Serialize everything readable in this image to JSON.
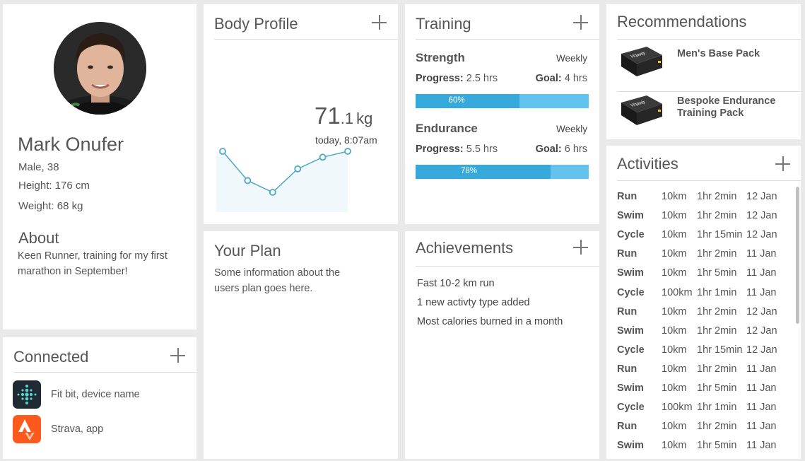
{
  "profile": {
    "name": "Mark Onufer",
    "gender_age": "Male, 38",
    "height": "Height: 176 cm",
    "weight": "Weight: 68 kg",
    "about_heading": "About",
    "about_text": "Keen Runner, training for my first marathon in September!"
  },
  "connected": {
    "title": "Connected",
    "items": [
      {
        "label": "Fit bit, device name",
        "icon": "fitbit-icon"
      },
      {
        "label": "Strava, app",
        "icon": "strava-icon"
      }
    ]
  },
  "body_profile": {
    "title": "Body Profile",
    "weight_int": "71",
    "weight_dec": ".1",
    "weight_unit": "kg",
    "weight_time": "today, 8:07am",
    "trend": [
      5,
      2.5,
      1.5,
      3.5,
      4.5,
      5
    ]
  },
  "plan": {
    "title": "Your Plan",
    "text": "Some information about the users plan goes here."
  },
  "training": {
    "title": "Training",
    "items": [
      {
        "name": "Strength",
        "period": "Weekly",
        "progress_label": "Progress:",
        "progress_value": "2.5 hrs",
        "goal_label": "Goal:",
        "goal_value": "4 hrs",
        "percent": 60,
        "percent_label": "60%"
      },
      {
        "name": "Endurance",
        "period": "Weekly",
        "progress_label": "Progress:",
        "progress_value": "5.5 hrs",
        "goal_label": "Goal:",
        "goal_value": "6 hrs",
        "percent": 78,
        "percent_label": "78%"
      }
    ]
  },
  "achievements": {
    "title": "Achievements",
    "items": [
      "Fast 10-2 km run",
      "1 new activty type added",
      "Most calories burned in a month"
    ]
  },
  "recommendations": {
    "title": "Recommendations",
    "items": [
      {
        "name": "Men's Base Pack",
        "brand": "Vinpuity"
      },
      {
        "name": "Bespoke Endurance Training Pack",
        "brand": "Vinpuity"
      }
    ]
  },
  "activities": {
    "title": "Activities",
    "rows": [
      [
        "Run",
        "10km",
        "1hr 2min",
        "12 Jan"
      ],
      [
        "Swim",
        "10km",
        "1hr 2min",
        "12 Jan"
      ],
      [
        "Cycle",
        "10km",
        "1hr 15min",
        "12 Jan"
      ],
      [
        "Run",
        "10km",
        "1hr 2min",
        "11 Jan"
      ],
      [
        "Swim",
        "10km",
        "1hr 5min",
        "11 Jan"
      ],
      [
        "Cycle",
        "100km",
        "1hr 1min",
        "11 Jan"
      ],
      [
        "Run",
        "10km",
        "1hr 2min",
        "12 Jan"
      ],
      [
        "Swim",
        "10km",
        "1hr 2min",
        "12 Jan"
      ],
      [
        "Cycle",
        "10km",
        "1hr 15min",
        "12 Jan"
      ],
      [
        "Run",
        "10km",
        "1hr 2min",
        "11 Jan"
      ],
      [
        "Swim",
        "10km",
        "1hr 5min",
        "11 Jan"
      ],
      [
        "Cycle",
        "100km",
        "1hr 1min",
        "11 Jan"
      ],
      [
        "Run",
        "10km",
        "1hr 2min",
        "11 Jan"
      ],
      [
        "Swim",
        "10km",
        "1hr 5min",
        "11 Jan"
      ]
    ]
  },
  "colors": {
    "bar_fill": "#36a9dc",
    "bar_track": "#62c4ee",
    "chart_line": "#4aa8c6",
    "fitbit_bg": "#1f2a33",
    "strava_bg": "#fc5a1c"
  }
}
